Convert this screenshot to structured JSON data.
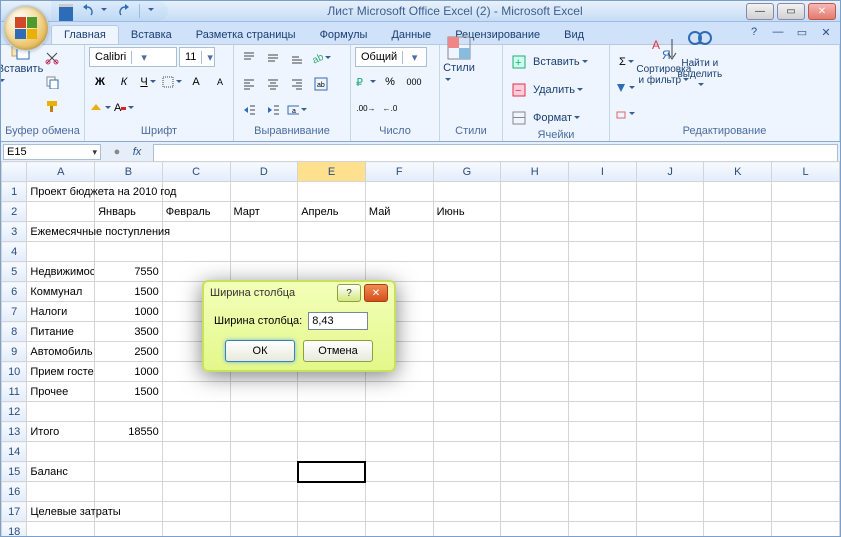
{
  "titlebar": {
    "doc_title": "Лист Microsoft Office Excel (2) - Microsoft Excel"
  },
  "tabs": {
    "items": [
      "Главная",
      "Вставка",
      "Разметка страницы",
      "Формулы",
      "Данные",
      "Рецензирование",
      "Вид"
    ],
    "active_index": 0
  },
  "ribbon": {
    "clipboard": {
      "title": "Буфер обмена",
      "paste": "Вставить"
    },
    "font": {
      "title": "Шрифт",
      "name": "Calibri",
      "size": "11",
      "bold": "Ж",
      "italic": "К",
      "underline": "Ч"
    },
    "alignment": {
      "title": "Выравнивание"
    },
    "number": {
      "title": "Число",
      "format": "Общий"
    },
    "styles": {
      "title": "Стили",
      "label": "Стили"
    },
    "cells": {
      "title": "Ячейки",
      "insert": "Вставить",
      "delete": "Удалить",
      "format": "Формат"
    },
    "editing": {
      "title": "Редактирование",
      "sort": "Сортировка и фильтр",
      "find": "Найти и выделить"
    }
  },
  "fxbar": {
    "namebox": "E15",
    "fx_label": "fx",
    "formula": ""
  },
  "columns": [
    "A",
    "B",
    "C",
    "D",
    "E",
    "F",
    "G",
    "H",
    "I",
    "J",
    "K",
    "L"
  ],
  "selected_col_index": 4,
  "selected_cell_row": 15,
  "selected_cell_col": 4,
  "rows": [
    {
      "n": 1,
      "cells": [
        "Проект бюджета на 2010 год",
        "",
        "",
        "",
        "",
        "",
        "",
        "",
        "",
        "",
        "",
        ""
      ],
      "spanfirst": 3
    },
    {
      "n": 2,
      "cells": [
        "",
        "Январь",
        "Февраль",
        "Март",
        "Апрель",
        "Май",
        "Июнь",
        "",
        "",
        "",
        "",
        ""
      ]
    },
    {
      "n": 3,
      "cells": [
        "Ежемесячные поступления",
        "",
        "",
        "",
        "",
        "",
        "",
        "",
        "",
        "",
        "",
        ""
      ],
      "spanfirst": 3
    },
    {
      "n": 4,
      "cells": [
        "",
        "",
        "",
        "",
        "",
        "",
        "",
        "",
        "",
        "",
        "",
        ""
      ]
    },
    {
      "n": 5,
      "cells": [
        "Недвижимость",
        "7550",
        "",
        "",
        "",
        "",
        "",
        "",
        "",
        "",
        "",
        ""
      ],
      "clipfirst": true,
      "numcol": 1
    },
    {
      "n": 6,
      "cells": [
        "Коммунал",
        "1500",
        "",
        "",
        "",
        "",
        "",
        "",
        "",
        "",
        "",
        ""
      ],
      "clipfirst": true,
      "numcol": 1
    },
    {
      "n": 7,
      "cells": [
        "Налоги",
        "1000",
        "",
        "",
        "",
        "",
        "",
        "",
        "",
        "",
        "",
        ""
      ],
      "numcol": 1
    },
    {
      "n": 8,
      "cells": [
        "Питание",
        "3500",
        "",
        "",
        "",
        "",
        "",
        "",
        "",
        "",
        "",
        ""
      ],
      "numcol": 1
    },
    {
      "n": 9,
      "cells": [
        "Автомобиль",
        "2500",
        "",
        "",
        "",
        "",
        "",
        "",
        "",
        "",
        "",
        ""
      ],
      "clipfirst": true,
      "numcol": 1
    },
    {
      "n": 10,
      "cells": [
        "Прием гостей",
        "1000",
        "",
        "",
        "",
        "",
        "",
        "",
        "",
        "",
        "",
        ""
      ],
      "clipfirst": true,
      "numcol": 1
    },
    {
      "n": 11,
      "cells": [
        "Прочее",
        "1500",
        "",
        "",
        "",
        "",
        "",
        "",
        "",
        "",
        "",
        ""
      ],
      "numcol": 1
    },
    {
      "n": 12,
      "cells": [
        "",
        "",
        "",
        "",
        "",
        "",
        "",
        "",
        "",
        "",
        "",
        ""
      ]
    },
    {
      "n": 13,
      "cells": [
        "Итого",
        "18550",
        "",
        "",
        "",
        "",
        "",
        "",
        "",
        "",
        "",
        ""
      ],
      "numcol": 1
    },
    {
      "n": 14,
      "cells": [
        "",
        "",
        "",
        "",
        "",
        "",
        "",
        "",
        "",
        "",
        "",
        ""
      ]
    },
    {
      "n": 15,
      "cells": [
        "Баланс",
        "",
        "",
        "",
        "",
        "",
        "",
        "",
        "",
        "",
        "",
        ""
      ]
    },
    {
      "n": 16,
      "cells": [
        "",
        "",
        "",
        "",
        "",
        "",
        "",
        "",
        "",
        "",
        "",
        ""
      ]
    },
    {
      "n": 17,
      "cells": [
        "Целевые затраты",
        "",
        "",
        "",
        "",
        "",
        "",
        "",
        "",
        "",
        "",
        ""
      ],
      "spanfirst": 2
    },
    {
      "n": 18,
      "cells": [
        "",
        "",
        "",
        "",
        "",
        "",
        "",
        "",
        "",
        "",
        "",
        ""
      ]
    }
  ],
  "dialog": {
    "title": "Ширина столбца",
    "label": "Ширина столбца:",
    "value": "8,43",
    "ok": "ОК",
    "cancel": "Отмена"
  }
}
